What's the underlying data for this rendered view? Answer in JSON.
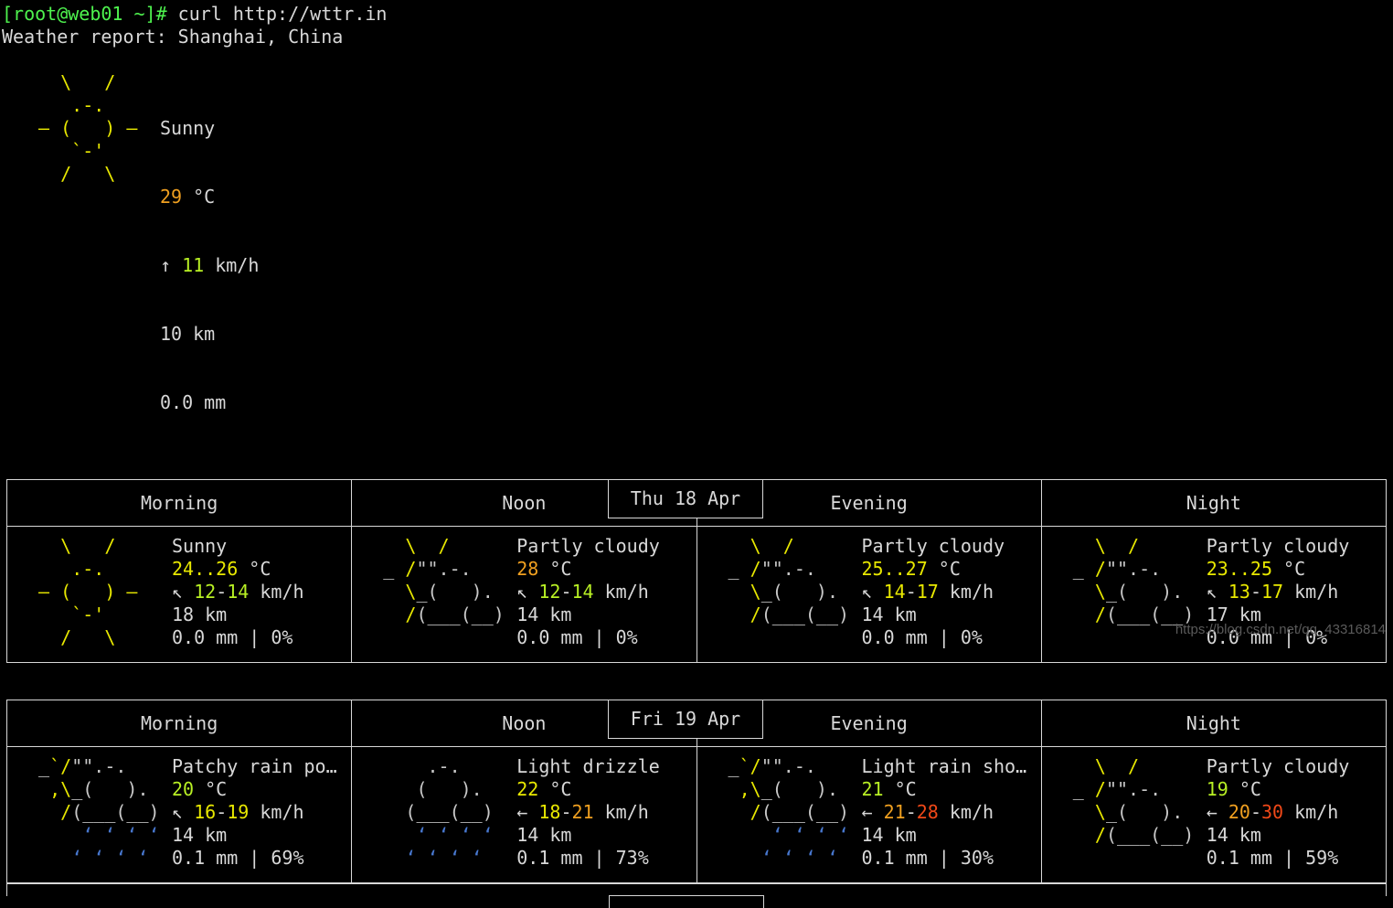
{
  "terminal": {
    "prompt": "[root@web01 ~]#",
    "command": " curl http://wttr.in",
    "report_line": "Weather report: Shanghai, China"
  },
  "current": {
    "art": [
      "   \\   /    ",
      "    .-.     ",
      " ― (   ) ―  ",
      "    `-'     ",
      "   /   \\    "
    ],
    "condition": "Sunny",
    "temp": "29",
    "temp_unit": " °C",
    "wind_arrow": "↑",
    "wind": "11",
    "wind_unit": " km/h",
    "visibility": "10 km",
    "precip": "0.0 mm"
  },
  "days": [
    {
      "date": "Thu 18 Apr",
      "columns": [
        {
          "header": "Morning",
          "art_type": "sunny",
          "art": [
            "   \\   /     ",
            "    .-.      ",
            " ― (   ) ―   ",
            "    `-'      ",
            "   /   \\     "
          ],
          "condition": "Sunny",
          "temp": "24..26",
          "temp_color": "yellow",
          "temp_unit": " °C",
          "wind_arrow": "↖",
          "wind_lo": "12",
          "wind_hi": "14",
          "wind_lo_color": "ltgreen",
          "wind_hi_color": "ltgreen",
          "wind_unit": " km/h",
          "visibility": "18 km",
          "precip": "0.0 mm | 0%"
        },
        {
          "header": "Noon",
          "art_type": "partly",
          "art": [
            "   \\  /      ",
            " _ /\"\".-.    ",
            "   \\_(   ).  ",
            "   /(___(__) "
          ],
          "condition": "Partly cloudy",
          "temp": "28",
          "temp_color": "orange",
          "temp_unit": " °C",
          "wind_arrow": "↖",
          "wind_lo": "12",
          "wind_hi": "14",
          "wind_lo_color": "ltgreen",
          "wind_hi_color": "ltgreen",
          "wind_unit": " km/h",
          "visibility": "14 km",
          "precip": "0.0 mm | 0%"
        },
        {
          "header": "Evening",
          "art_type": "partly",
          "art": [
            "   \\  /      ",
            " _ /\"\".-.    ",
            "   \\_(   ).  ",
            "   /(___(__) "
          ],
          "condition": "Partly cloudy",
          "temp": "25..27",
          "temp_color": "yellow",
          "temp_unit": " °C",
          "wind_arrow": "↖",
          "wind_lo": "14",
          "wind_hi": "17",
          "wind_lo_color": "yellow",
          "wind_hi_color": "yellow",
          "wind_unit": " km/h",
          "visibility": "14 km",
          "precip": "0.0 mm | 0%"
        },
        {
          "header": "Night",
          "art_type": "partly",
          "art": [
            "   \\  /      ",
            " _ /\"\".-.    ",
            "   \\_(   ).  ",
            "   /(___(__) "
          ],
          "condition": "Partly cloudy",
          "temp": "23..25",
          "temp_color": "yellow",
          "temp_unit": " °C",
          "wind_arrow": "↖",
          "wind_lo": "13",
          "wind_hi": "17",
          "wind_lo_color": "yellow",
          "wind_hi_color": "yellow",
          "wind_unit": " km/h",
          "visibility": "17 km",
          "precip": "0.0 mm | 0%"
        }
      ]
    },
    {
      "date": "Fri 19 Apr",
      "columns": [
        {
          "header": "Morning",
          "art_type": "rain-sun",
          "art": [
            " _`/\"\".-.    ",
            "  ,\\_(   ).  ",
            "   /(___(__) ",
            "     ‘ ‘ ‘ ‘ ",
            "    ‘ ‘ ‘ ‘  "
          ],
          "condition": "Patchy rain po…",
          "temp": "20",
          "temp_color": "ltgreen",
          "temp_unit": " °C",
          "wind_arrow": "↖",
          "wind_lo": "16",
          "wind_hi": "19",
          "wind_lo_color": "yellow",
          "wind_hi_color": "yellow",
          "wind_unit": " km/h",
          "visibility": "14 km",
          "precip": "0.1 mm | 69%"
        },
        {
          "header": "Noon",
          "art_type": "rain",
          "art": [
            "     .-.     ",
            "    (   ).   ",
            "   (___(__)  ",
            "    ‘ ‘ ‘ ‘  ",
            "   ‘ ‘ ‘ ‘   "
          ],
          "condition": "Light drizzle",
          "temp": "22",
          "temp_color": "yellow",
          "temp_unit": " °C",
          "wind_arrow": "←",
          "wind_lo": "18",
          "wind_hi": "21",
          "wind_lo_color": "yellow",
          "wind_hi_color": "orange",
          "wind_unit": " km/h",
          "visibility": "14 km",
          "precip": "0.1 mm | 73%"
        },
        {
          "header": "Evening",
          "art_type": "rain-sun",
          "art": [
            " _`/\"\".-.    ",
            "  ,\\_(   ).  ",
            "   /(___(__) ",
            "     ‘ ‘ ‘ ‘ ",
            "    ‘ ‘ ‘ ‘  "
          ],
          "condition": "Light rain sho…",
          "temp": "21",
          "temp_color": "ltgreen",
          "temp_unit": " °C",
          "wind_arrow": "←",
          "wind_lo": "21",
          "wind_hi": "28",
          "wind_lo_color": "orange",
          "wind_hi_color": "red",
          "wind_unit": " km/h",
          "visibility": "14 km",
          "precip": "0.1 mm | 30%"
        },
        {
          "header": "Night",
          "art_type": "partly",
          "art": [
            "   \\  /      ",
            " _ /\"\".-.    ",
            "   \\_(   ).  ",
            "   /(___(__) "
          ],
          "condition": "Partly cloudy",
          "temp": "19",
          "temp_color": "ltgreen",
          "temp_unit": " °C",
          "wind_arrow": "←",
          "wind_lo": "20",
          "wind_hi": "30",
          "wind_lo_color": "orange",
          "wind_hi_color": "red",
          "wind_unit": " km/h",
          "visibility": "14 km",
          "precip": "0.1 mm | 59%"
        }
      ]
    }
  ],
  "watermark": "https://blog.csdn.net/qq_43316814"
}
